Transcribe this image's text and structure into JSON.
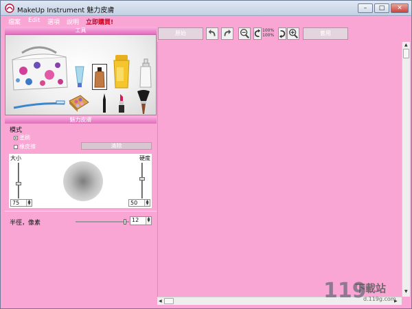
{
  "window": {
    "title": "MakeUp Instrument 魅力皮膚",
    "controls": [
      "–",
      "□",
      "✕"
    ]
  },
  "menu": {
    "items": [
      "檔案",
      "Edit",
      "選項",
      "說明"
    ],
    "buy": "立即購買!"
  },
  "tools_panel": {
    "header": "工具",
    "items": [
      "cosmetic-bag",
      "cream-tube",
      "foundation-bottle",
      "powder-tin",
      "lotion-bottle",
      "toothbrush",
      "eyeshadow-palette",
      "eyeliner",
      "lipstick",
      "powder-brush"
    ]
  },
  "charm_panel": {
    "header": "魅力皮膚",
    "mode_label": "模式",
    "mode_paint": "塗刷",
    "mode_erase": "橡皮擦",
    "clear_button": "清除",
    "size_label": "大小",
    "hardness_label": "硬度",
    "size_value": "75",
    "hardness_value": "50",
    "size_level": 0.4,
    "hardness_level": 0.55,
    "radius_label": "半徑，像素",
    "radius_value": "12",
    "radius_level": 0.95
  },
  "toolbar": {
    "original_label": "原始",
    "zoom_top": "100%",
    "zoom_bottom": "100%",
    "apply_label": "套用"
  },
  "watermark": {
    "number": "119",
    "name": "下載站",
    "url": "d.119g.com"
  },
  "colors": {
    "background": "#f9a6d5",
    "header": "#e36bbd",
    "buy": "#d4001c"
  }
}
